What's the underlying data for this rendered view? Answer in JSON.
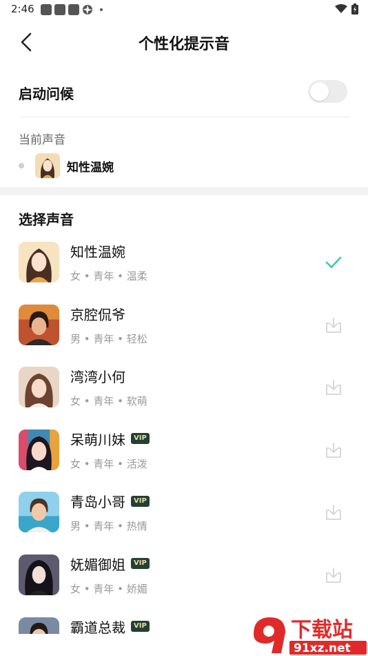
{
  "status_bar": {
    "time": "2:46"
  },
  "header": {
    "title": "个性化提示音"
  },
  "greeting": {
    "label": "启动问候",
    "enabled": false
  },
  "current_voice": {
    "label": "当前声音",
    "name": "知性温婉"
  },
  "select_section": {
    "title": "选择声音"
  },
  "voices": [
    {
      "name": "知性温婉",
      "tags": "女 • 青年 • 温柔",
      "vip": false,
      "selected": true
    },
    {
      "name": "京腔侃爷",
      "tags": "男 • 青年 • 轻松",
      "vip": false,
      "selected": false
    },
    {
      "name": "湾湾小何",
      "tags": "女 • 青年 • 软萌",
      "vip": false,
      "selected": false
    },
    {
      "name": "呆萌川妹",
      "tags": "女 • 青年 • 活泼",
      "vip": true,
      "selected": false
    },
    {
      "name": "青岛小哥",
      "tags": "男 • 青年 • 热情",
      "vip": true,
      "selected": false
    },
    {
      "name": "妩媚御姐",
      "tags": "女 • 青年 • 娇媚",
      "vip": true,
      "selected": false
    },
    {
      "name": "霸道总裁",
      "tags": "",
      "vip": true,
      "selected": false
    }
  ],
  "vip_label": "VIP",
  "watermark": {
    "text_top": "下载站",
    "text_bottom": "91xz.net"
  },
  "colors": {
    "accent": "#3ec9b4",
    "vip_bg": "#244034",
    "vip_text": "#e8d9a6",
    "icon_muted": "#d4d4d4"
  }
}
